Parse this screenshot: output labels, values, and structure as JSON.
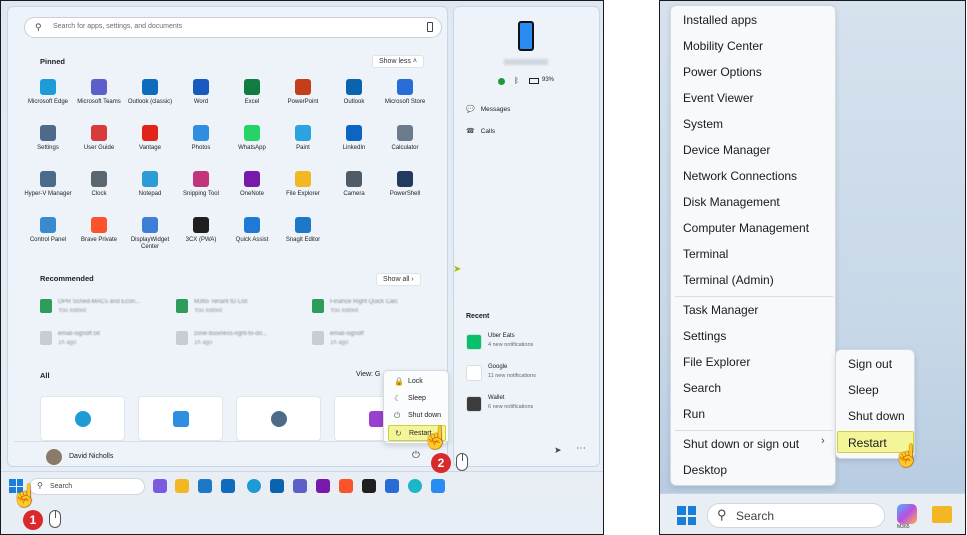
{
  "start": {
    "search_placeholder": "Search for apps, settings, and documents",
    "pinned_title": "Pinned",
    "show_less": "Show less",
    "apps": [
      {
        "label": "Microsoft Edge",
        "color": "#1d9bd7"
      },
      {
        "label": "Microsoft Teams",
        "color": "#5b5fc7"
      },
      {
        "label": "Outlook (classic)",
        "color": "#0f6cbd"
      },
      {
        "label": "Word",
        "color": "#185abd"
      },
      {
        "label": "Excel",
        "color": "#107c41"
      },
      {
        "label": "PowerPoint",
        "color": "#c43e1c"
      },
      {
        "label": "Outlook",
        "color": "#0a64ad"
      },
      {
        "label": "Microsoft Store",
        "color": "#2a6cd6"
      },
      {
        "label": "Settings",
        "color": "#4d6b89"
      },
      {
        "label": "User Guide",
        "color": "#d83b3b"
      },
      {
        "label": "Vantage",
        "color": "#e2231a"
      },
      {
        "label": "Photos",
        "color": "#2f8ee0"
      },
      {
        "label": "WhatsApp",
        "color": "#25d366"
      },
      {
        "label": "Paint",
        "color": "#2aa3e0"
      },
      {
        "label": "LinkedIn",
        "color": "#0a66c2"
      },
      {
        "label": "Calculator",
        "color": "#6b7b8c"
      },
      {
        "label": "Hyper-V Manager",
        "color": "#4a6a8a"
      },
      {
        "label": "Clock",
        "color": "#5a6670"
      },
      {
        "label": "Notepad",
        "color": "#2c9bd6"
      },
      {
        "label": "Snipping Tool",
        "color": "#c2357a"
      },
      {
        "label": "OneNote",
        "color": "#7719aa"
      },
      {
        "label": "File Explorer",
        "color": "#f2b723"
      },
      {
        "label": "Camera",
        "color": "#4f5c68"
      },
      {
        "label": "PowerShell",
        "color": "#223a5e"
      },
      {
        "label": "Control Panel",
        "color": "#3a8ad0"
      },
      {
        "label": "Brave Private",
        "color": "#fb542b"
      },
      {
        "label": "DisplayWidget Center",
        "color": "#3d7fd6"
      },
      {
        "label": "3CX (PWA)",
        "color": "#1f1f1f"
      },
      {
        "label": "Quick Assist",
        "color": "#1f7ad6"
      },
      {
        "label": "Snagit Editor",
        "color": "#1e78c8"
      }
    ],
    "recommended_title": "Recommended",
    "show_all": "Show all",
    "recommended": [
      {
        "title": "OPR Sched-MACs and Econ...",
        "sub": "You edited",
        "color": "#2e9c5a"
      },
      {
        "title": "M365 Tenant ID List",
        "sub": "You edited",
        "color": "#2e9c5a"
      },
      {
        "title": "Finance Right Quick Calc",
        "sub": "You edited",
        "color": "#2e9c5a"
      },
      {
        "title": "email-signoff.txt",
        "sub": "1h ago",
        "color": "#c9ccd0"
      },
      {
        "title": "zone-business-right-to-do...",
        "sub": "1h ago",
        "color": "#c9ccd0"
      },
      {
        "title": "email-signoff",
        "sub": "1h ago",
        "color": "#c9ccd0"
      }
    ],
    "all_title": "All",
    "view_label": "View: G",
    "power_menu": [
      {
        "label": "Lock",
        "icon": "🔒"
      },
      {
        "label": "Sleep",
        "icon": "☾"
      },
      {
        "label": "Shut down",
        "icon": "⏻"
      },
      {
        "label": "Restart",
        "icon": "↻"
      }
    ],
    "user_name": "David Nicholls",
    "taskbar_search": "Search"
  },
  "phone_panel": {
    "battery": "93%",
    "links": [
      {
        "label": "Messages"
      },
      {
        "label": "Calls"
      }
    ],
    "recent_title": "Recent",
    "recent": [
      {
        "app": "Uber Eats",
        "sub": "4 new notifications",
        "color": "#06c167"
      },
      {
        "app": "Google",
        "sub": "11 new notifications",
        "color": "#ffffff"
      },
      {
        "app": "Wallet",
        "sub": "6 new notifications",
        "color": "#3c3c3c"
      }
    ]
  },
  "badges": {
    "one": "1",
    "two": "2"
  },
  "context_menu": {
    "items": [
      {
        "label": "Installed apps"
      },
      {
        "label": "Mobility Center"
      },
      {
        "label": "Power Options"
      },
      {
        "label": "Event Viewer"
      },
      {
        "label": "System"
      },
      {
        "label": "Device Manager"
      },
      {
        "label": "Network Connections"
      },
      {
        "label": "Disk Management"
      },
      {
        "label": "Computer Management"
      },
      {
        "label": "Terminal"
      },
      {
        "label": "Terminal (Admin)"
      },
      {
        "label": "Task Manager"
      },
      {
        "label": "Settings"
      },
      {
        "label": "File Explorer"
      },
      {
        "label": "Search"
      },
      {
        "label": "Run"
      },
      {
        "label": "Shut down or sign out"
      },
      {
        "label": "Desktop"
      }
    ],
    "submenu": [
      {
        "label": "Sign out"
      },
      {
        "label": "Sleep"
      },
      {
        "label": "Shut down"
      },
      {
        "label": "Restart"
      }
    ],
    "taskbar_search": "Search",
    "m365_label": "M365"
  },
  "colors": {
    "highlight": "#f4f599",
    "badge": "#d9292b"
  }
}
